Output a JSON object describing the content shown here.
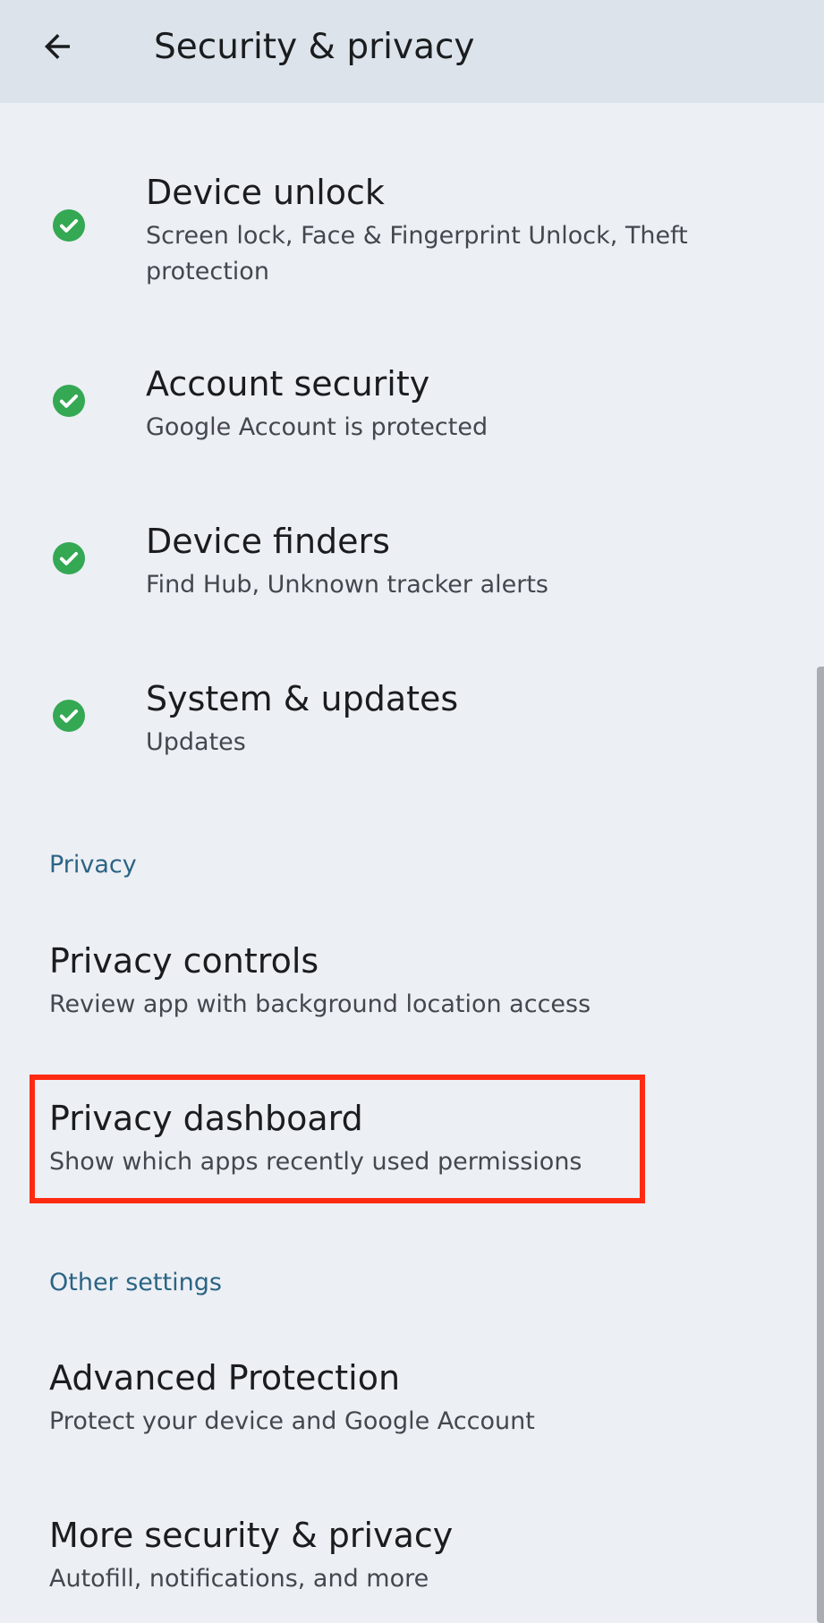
{
  "app_bar": {
    "title": "Security & privacy",
    "back_icon": "arrow-back-icon"
  },
  "status_items": [
    {
      "title": "Device unlock",
      "summary_line1": "Screen lock, Face & Fingerprint Unlock, Theft",
      "summary_line2": "protection",
      "status_icon": "check-circle-icon",
      "status_color": "#34a853"
    },
    {
      "title": "Account security",
      "summary_line1": "Google Account is protected",
      "status_icon": "check-circle-icon",
      "status_color": "#34a853"
    },
    {
      "title": "Device finders",
      "summary_line1": "Find Hub, Unknown tracker alerts",
      "status_icon": "check-circle-icon",
      "status_color": "#34a853"
    },
    {
      "title": "System & updates",
      "summary_line1": "Updates",
      "status_icon": "check-circle-icon",
      "status_color": "#34a853"
    }
  ],
  "privacy_section": {
    "header": "Privacy",
    "items": [
      {
        "title": "Privacy controls",
        "summary": "Review app with background location access"
      },
      {
        "title": "Privacy dashboard",
        "summary": "Show which apps recently used permissions",
        "highlighted": true
      }
    ]
  },
  "other_section": {
    "header": "Other settings",
    "items": [
      {
        "title": "Advanced Protection",
        "summary": "Protect your device and Google Account"
      },
      {
        "title": "More security & privacy",
        "summary": "Autofill, notifications, and more"
      }
    ]
  },
  "colors": {
    "background": "#eceff4",
    "app_bar": "#dde3eb",
    "section_header": "#2b6484",
    "highlight": "#ff2a12",
    "check": "#34a853"
  }
}
